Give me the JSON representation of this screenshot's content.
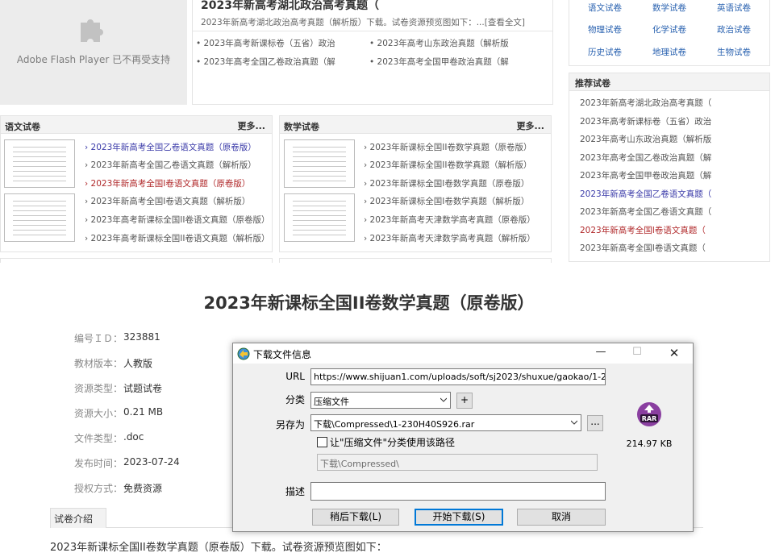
{
  "flash": {
    "message": "Adobe Flash Player 已不再受支持"
  },
  "top_article": {
    "title": "2023年新高考湖北政治高考真题（",
    "desc": "2023年新高考湖北政治高考真题（解析版）下载。试卷资源预览图如下：...[查看全文]",
    "links": [
      "• 2023年高考新课标卷（五省）政治",
      "• 2023年高考山东政治真题（解析版",
      "• 2023年高考全国乙卷政治真题（解",
      "• 2023年高考全国甲卷政治真题（解"
    ]
  },
  "subjects": [
    "语文试卷",
    "数学试卷",
    "英语试卷",
    "物理试卷",
    "化学试卷",
    "政治试卷",
    "历史试卷",
    "地理试卷",
    "生物试卷"
  ],
  "recommend": {
    "title": "推荐试卷",
    "items": [
      "2023年新高考湖北政治高考真题（",
      "2023年高考新课标卷（五省）政治",
      "2023年高考山东政治真题（解析版",
      "2023年高考全国乙卷政治真题（解",
      "2023年高考全国甲卷政治真题（解",
      "2023年新高考全国乙卷语文真题（",
      "2023年新高考全国乙卷语文真题（",
      "2023年新高考全国I卷语文真题（",
      "2023年新高考全国I卷语文真题（"
    ]
  },
  "chinese_panel": {
    "title": "语文试卷",
    "more": "更多...",
    "items": [
      "› 2023年新高考全国乙卷语文真题（原卷版）",
      "› 2023年新高考全国乙卷语文真题（解析版）",
      "› 2023年新高考全国I卷语文真题（原卷版）",
      "› 2023年新高考全国I卷语文真题（解析版）",
      "› 2023年高考新课标全国II卷语文真题（原卷版）",
      "› 2023年高考新课标全国II卷语文真题（解析版）"
    ]
  },
  "math_panel": {
    "title": "数学试卷",
    "more": "更多...",
    "items": [
      "› 2023年新课标全国II卷数学真题（原卷版）",
      "› 2023年新课标全国II卷数学真题（解析版）",
      "› 2023年新课标全国I卷数学真题（原卷版）",
      "› 2023年新课标全国I卷数学真题（解析版）",
      "› 2023年新高考天津数学高考真题（原卷版）",
      "› 2023年新高考天津数学高考真题（解析版）"
    ]
  },
  "detail": {
    "title": "2023年新课标全国II卷数学真题（原卷版）",
    "fields": [
      {
        "label": "编号ＩＤ：",
        "value": "323881"
      },
      {
        "label": "教材版本：",
        "value": "人教版"
      },
      {
        "label": "资源类型：",
        "value": "试题试卷"
      },
      {
        "label": "资源大小：",
        "value": "0.21 MB"
      },
      {
        "label": "文件类型：",
        "value": ".doc"
      },
      {
        "label": "发布时间：",
        "value": "2023-07-24"
      },
      {
        "label": "授权方式：",
        "value": "免费资源"
      }
    ],
    "intro_tab": "试卷介绍",
    "intro_text": "2023年新课标全国II卷数学真题（原卷版）下载。试卷资源预览图如下："
  },
  "dialog": {
    "title": "下载文件信息",
    "url_label": "URL",
    "url": "https://www.shijuan1.com/uploads/soft/sj2023/shuxue/gaokao/1-230H40S926.rar",
    "category_label": "分类",
    "category": "压缩文件",
    "saveas_label": "另存为",
    "saveas": "下载\\Compressed\\1-230H40S926.rar",
    "checkbox_label": "让\"压缩文件\"分类使用该路径",
    "path": "下载\\Compressed\\",
    "desc_label": "描述",
    "desc": "",
    "file_size": "214.97 KB",
    "file_icon_text": "RAR",
    "btn_later": "稍后下载(L)",
    "btn_start": "开始下载(S)",
    "btn_cancel": "取消",
    "plus": "+",
    "browse": "..."
  },
  "colors": {
    "link_blue": "#2a62b0",
    "link_purple": "#3a3aa8",
    "link_red": "#b0282a",
    "rar_purple": "#8a3fa0"
  }
}
